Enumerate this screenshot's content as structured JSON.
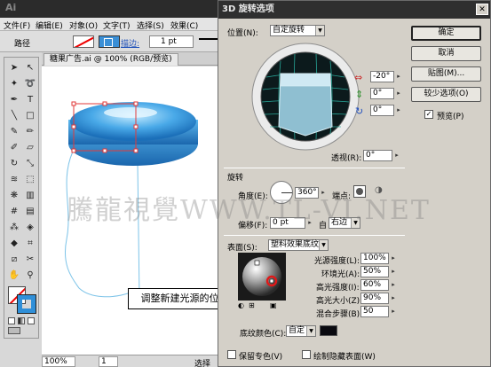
{
  "app": {
    "logo": "Ai",
    "menu": [
      "文件(F)",
      "编辑(E)",
      "对象(O)",
      "文字(T)",
      "选择(S)",
      "效果(C)"
    ],
    "control_bar": {
      "label": "路径",
      "stroke_label": "描边:",
      "stroke_value": "1 pt"
    },
    "document_tab": "糖果广告.ai @ 100% (RGB/预览)",
    "status": {
      "zoom": "100%",
      "page": "1",
      "mode": "选择"
    },
    "tooltip": "调整新建光源的位置",
    "watermark": "騰龍視覺WWW.TL-VI.NET"
  },
  "dialog": {
    "title": "3D 旋转选项",
    "close_glyph": "✕",
    "position": {
      "label": "位置(N):",
      "value": "自定旋转"
    },
    "rotation_x": "-20°",
    "rotation_y": "0°",
    "rotation_z": "0°",
    "perspective": {
      "label": "透视(R):",
      "value": "0°"
    },
    "extrude_section": "旋转",
    "angle": {
      "label": "角度(E):",
      "value": "360°"
    },
    "cap": {
      "label": "端点:"
    },
    "offset": {
      "label": "偏移(F):",
      "value": "0 pt",
      "from_label": "自",
      "from_value": "右边"
    },
    "surface": {
      "label": "表面(S):",
      "value": "塑料效果底纹"
    },
    "lighting": {
      "intensity": {
        "label": "光源强度(L):",
        "value": "100%"
      },
      "ambient": {
        "label": "环境光(A):",
        "value": "50%"
      },
      "highlight_intensity": {
        "label": "高光强度(I):",
        "value": "60%"
      },
      "highlight_size": {
        "label": "高光大小(Z):",
        "value": "90%"
      },
      "blend_steps": {
        "label": "混合步骤(B):",
        "value": "50"
      }
    },
    "shading_color": {
      "label": "底纹颜色(C):",
      "value": "自定"
    },
    "preserve_spot": "保留专色(V)",
    "draw_hidden": "绘制隐藏表面(W)",
    "buttons": {
      "ok": "确定",
      "cancel": "取消",
      "map": "贴图(M)...",
      "fewer": "较少选项(O)",
      "preview": "预览(P)"
    },
    "preview_checked": "✓"
  },
  "colors": {
    "candy": "#2f8fd8",
    "candy_light": "#9dd6fb",
    "selection": "#e23a3a",
    "path": "#7cc3e8"
  }
}
